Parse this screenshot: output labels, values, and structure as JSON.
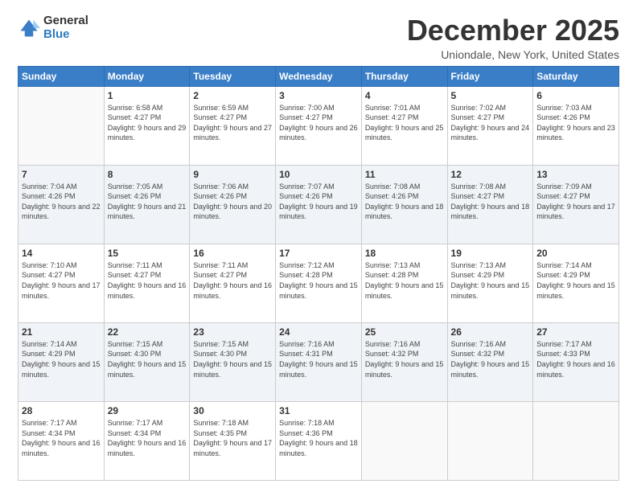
{
  "logo": {
    "general": "General",
    "blue": "Blue"
  },
  "header": {
    "title": "December 2025",
    "location": "Uniondale, New York, United States"
  },
  "weekdays": [
    "Sunday",
    "Monday",
    "Tuesday",
    "Wednesday",
    "Thursday",
    "Friday",
    "Saturday"
  ],
  "weeks": [
    [
      {
        "day": "",
        "sunrise": "",
        "sunset": "",
        "daylight": ""
      },
      {
        "day": "1",
        "sunrise": "Sunrise: 6:58 AM",
        "sunset": "Sunset: 4:27 PM",
        "daylight": "Daylight: 9 hours and 29 minutes."
      },
      {
        "day": "2",
        "sunrise": "Sunrise: 6:59 AM",
        "sunset": "Sunset: 4:27 PM",
        "daylight": "Daylight: 9 hours and 27 minutes."
      },
      {
        "day": "3",
        "sunrise": "Sunrise: 7:00 AM",
        "sunset": "Sunset: 4:27 PM",
        "daylight": "Daylight: 9 hours and 26 minutes."
      },
      {
        "day": "4",
        "sunrise": "Sunrise: 7:01 AM",
        "sunset": "Sunset: 4:27 PM",
        "daylight": "Daylight: 9 hours and 25 minutes."
      },
      {
        "day": "5",
        "sunrise": "Sunrise: 7:02 AM",
        "sunset": "Sunset: 4:27 PM",
        "daylight": "Daylight: 9 hours and 24 minutes."
      },
      {
        "day": "6",
        "sunrise": "Sunrise: 7:03 AM",
        "sunset": "Sunset: 4:26 PM",
        "daylight": "Daylight: 9 hours and 23 minutes."
      }
    ],
    [
      {
        "day": "7",
        "sunrise": "Sunrise: 7:04 AM",
        "sunset": "Sunset: 4:26 PM",
        "daylight": "Daylight: 9 hours and 22 minutes."
      },
      {
        "day": "8",
        "sunrise": "Sunrise: 7:05 AM",
        "sunset": "Sunset: 4:26 PM",
        "daylight": "Daylight: 9 hours and 21 minutes."
      },
      {
        "day": "9",
        "sunrise": "Sunrise: 7:06 AM",
        "sunset": "Sunset: 4:26 PM",
        "daylight": "Daylight: 9 hours and 20 minutes."
      },
      {
        "day": "10",
        "sunrise": "Sunrise: 7:07 AM",
        "sunset": "Sunset: 4:26 PM",
        "daylight": "Daylight: 9 hours and 19 minutes."
      },
      {
        "day": "11",
        "sunrise": "Sunrise: 7:08 AM",
        "sunset": "Sunset: 4:26 PM",
        "daylight": "Daylight: 9 hours and 18 minutes."
      },
      {
        "day": "12",
        "sunrise": "Sunrise: 7:08 AM",
        "sunset": "Sunset: 4:27 PM",
        "daylight": "Daylight: 9 hours and 18 minutes."
      },
      {
        "day": "13",
        "sunrise": "Sunrise: 7:09 AM",
        "sunset": "Sunset: 4:27 PM",
        "daylight": "Daylight: 9 hours and 17 minutes."
      }
    ],
    [
      {
        "day": "14",
        "sunrise": "Sunrise: 7:10 AM",
        "sunset": "Sunset: 4:27 PM",
        "daylight": "Daylight: 9 hours and 17 minutes."
      },
      {
        "day": "15",
        "sunrise": "Sunrise: 7:11 AM",
        "sunset": "Sunset: 4:27 PM",
        "daylight": "Daylight: 9 hours and 16 minutes."
      },
      {
        "day": "16",
        "sunrise": "Sunrise: 7:11 AM",
        "sunset": "Sunset: 4:27 PM",
        "daylight": "Daylight: 9 hours and 16 minutes."
      },
      {
        "day": "17",
        "sunrise": "Sunrise: 7:12 AM",
        "sunset": "Sunset: 4:28 PM",
        "daylight": "Daylight: 9 hours and 15 minutes."
      },
      {
        "day": "18",
        "sunrise": "Sunrise: 7:13 AM",
        "sunset": "Sunset: 4:28 PM",
        "daylight": "Daylight: 9 hours and 15 minutes."
      },
      {
        "day": "19",
        "sunrise": "Sunrise: 7:13 AM",
        "sunset": "Sunset: 4:29 PM",
        "daylight": "Daylight: 9 hours and 15 minutes."
      },
      {
        "day": "20",
        "sunrise": "Sunrise: 7:14 AM",
        "sunset": "Sunset: 4:29 PM",
        "daylight": "Daylight: 9 hours and 15 minutes."
      }
    ],
    [
      {
        "day": "21",
        "sunrise": "Sunrise: 7:14 AM",
        "sunset": "Sunset: 4:29 PM",
        "daylight": "Daylight: 9 hours and 15 minutes."
      },
      {
        "day": "22",
        "sunrise": "Sunrise: 7:15 AM",
        "sunset": "Sunset: 4:30 PM",
        "daylight": "Daylight: 9 hours and 15 minutes."
      },
      {
        "day": "23",
        "sunrise": "Sunrise: 7:15 AM",
        "sunset": "Sunset: 4:30 PM",
        "daylight": "Daylight: 9 hours and 15 minutes."
      },
      {
        "day": "24",
        "sunrise": "Sunrise: 7:16 AM",
        "sunset": "Sunset: 4:31 PM",
        "daylight": "Daylight: 9 hours and 15 minutes."
      },
      {
        "day": "25",
        "sunrise": "Sunrise: 7:16 AM",
        "sunset": "Sunset: 4:32 PM",
        "daylight": "Daylight: 9 hours and 15 minutes."
      },
      {
        "day": "26",
        "sunrise": "Sunrise: 7:16 AM",
        "sunset": "Sunset: 4:32 PM",
        "daylight": "Daylight: 9 hours and 15 minutes."
      },
      {
        "day": "27",
        "sunrise": "Sunrise: 7:17 AM",
        "sunset": "Sunset: 4:33 PM",
        "daylight": "Daylight: 9 hours and 16 minutes."
      }
    ],
    [
      {
        "day": "28",
        "sunrise": "Sunrise: 7:17 AM",
        "sunset": "Sunset: 4:34 PM",
        "daylight": "Daylight: 9 hours and 16 minutes."
      },
      {
        "day": "29",
        "sunrise": "Sunrise: 7:17 AM",
        "sunset": "Sunset: 4:34 PM",
        "daylight": "Daylight: 9 hours and 16 minutes."
      },
      {
        "day": "30",
        "sunrise": "Sunrise: 7:18 AM",
        "sunset": "Sunset: 4:35 PM",
        "daylight": "Daylight: 9 hours and 17 minutes."
      },
      {
        "day": "31",
        "sunrise": "Sunrise: 7:18 AM",
        "sunset": "Sunset: 4:36 PM",
        "daylight": "Daylight: 9 hours and 18 minutes."
      },
      {
        "day": "",
        "sunrise": "",
        "sunset": "",
        "daylight": ""
      },
      {
        "day": "",
        "sunrise": "",
        "sunset": "",
        "daylight": ""
      },
      {
        "day": "",
        "sunrise": "",
        "sunset": "",
        "daylight": ""
      }
    ]
  ]
}
